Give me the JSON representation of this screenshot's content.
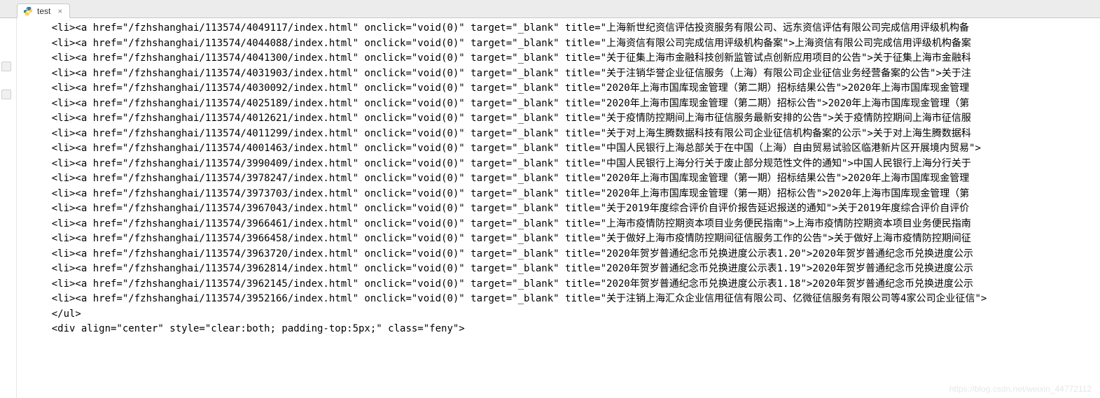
{
  "tab": {
    "filename": "test",
    "close_glyph": "×"
  },
  "watermark": "https://blog.csdn.net/weixin_44772112",
  "code": {
    "first_line_partial": "    <li><a href=\"/fzhshanghai/113574/4049117/index.html\" onclick=\"void(0)\" target=\"_blank\" title=\"上海新世纪资信评估投资服务有限公司、远东资信评估有限公司完成信用评级机构备",
    "entries": [
      {
        "id": "4044088",
        "title": "上海资信有限公司完成信用评级机构备案",
        "text": "上海资信有限公司完成信用评级机构备案"
      },
      {
        "id": "4041300",
        "title": "关于征集上海市金融科技创新监管试点创新应用项目的公告",
        "text": "关于征集上海市金融科"
      },
      {
        "id": "4031903",
        "title": "关于注销华誉企业征信服务（上海）有限公司企业征信业务经营备案的公告",
        "text": "关于注"
      },
      {
        "id": "4030092",
        "title": "2020年上海市国库现金管理（第二期）招标结果公告",
        "text": "2020年上海市国库现金管理"
      },
      {
        "id": "4025189",
        "title": "2020年上海市国库现金管理（第二期）招标公告",
        "text": "2020年上海市国库现金管理（第"
      },
      {
        "id": "4012621",
        "title": "关于疫情防控期间上海市征信服务最新安排的公告",
        "text": "关于疫情防控期间上海市征信服"
      },
      {
        "id": "4011299",
        "title": "关于对上海生腾数据科技有限公司企业征信机构备案的公示",
        "text": "关于对上海生腾数据科"
      },
      {
        "id": "4001463",
        "title": "中国人民银行上海总部关于在中国（上海）自由贸易试验区临港新片区开展境内贸易",
        "text": ""
      },
      {
        "id": "3990409",
        "title": "中国人民银行上海分行关于废止部分规范性文件的通知",
        "text": "中国人民银行上海分行关于"
      },
      {
        "id": "3978247",
        "title": "2020年上海市国库现金管理（第一期）招标结果公告",
        "text": "2020年上海市国库现金管理"
      },
      {
        "id": "3973703",
        "title": "2020年上海市国库现金管理（第一期）招标公告",
        "text": "2020年上海市国库现金管理（第"
      },
      {
        "id": "3967043",
        "title": "关于2019年度综合评价自评价报告延迟报送的通知",
        "text": "关于2019年度综合评价自评价"
      },
      {
        "id": "3966461",
        "title": "上海市疫情防控期资本项目业务便民指南",
        "text": "上海市疫情防控期资本项目业务便民指南"
      },
      {
        "id": "3966458",
        "title": "关于做好上海市疫情防控期间征信服务工作的公告",
        "text": "关于做好上海市疫情防控期间征"
      },
      {
        "id": "3963720",
        "title": "2020年贺岁普通纪念币兑换进度公示表1.20",
        "text": "2020年贺岁普通纪念币兑换进度公示"
      },
      {
        "id": "3962814",
        "title": "2020年贺岁普通纪念币兑换进度公示表1.19",
        "text": "2020年贺岁普通纪念币兑换进度公示"
      },
      {
        "id": "3962145",
        "title": "2020年贺岁普通纪念币兑换进度公示表1.18",
        "text": "2020年贺岁普通纪念币兑换进度公示"
      },
      {
        "id": "3952166",
        "title": "关于注销上海汇众企业信用征信有限公司、亿微征信服务有限公司等4家公司企业征信",
        "text": ""
      }
    ],
    "close_ul": "    </ul>",
    "div_line": "    <div align=\"center\" style=\"clear:both; padding-top:5px;\" class=\"feny\">"
  }
}
